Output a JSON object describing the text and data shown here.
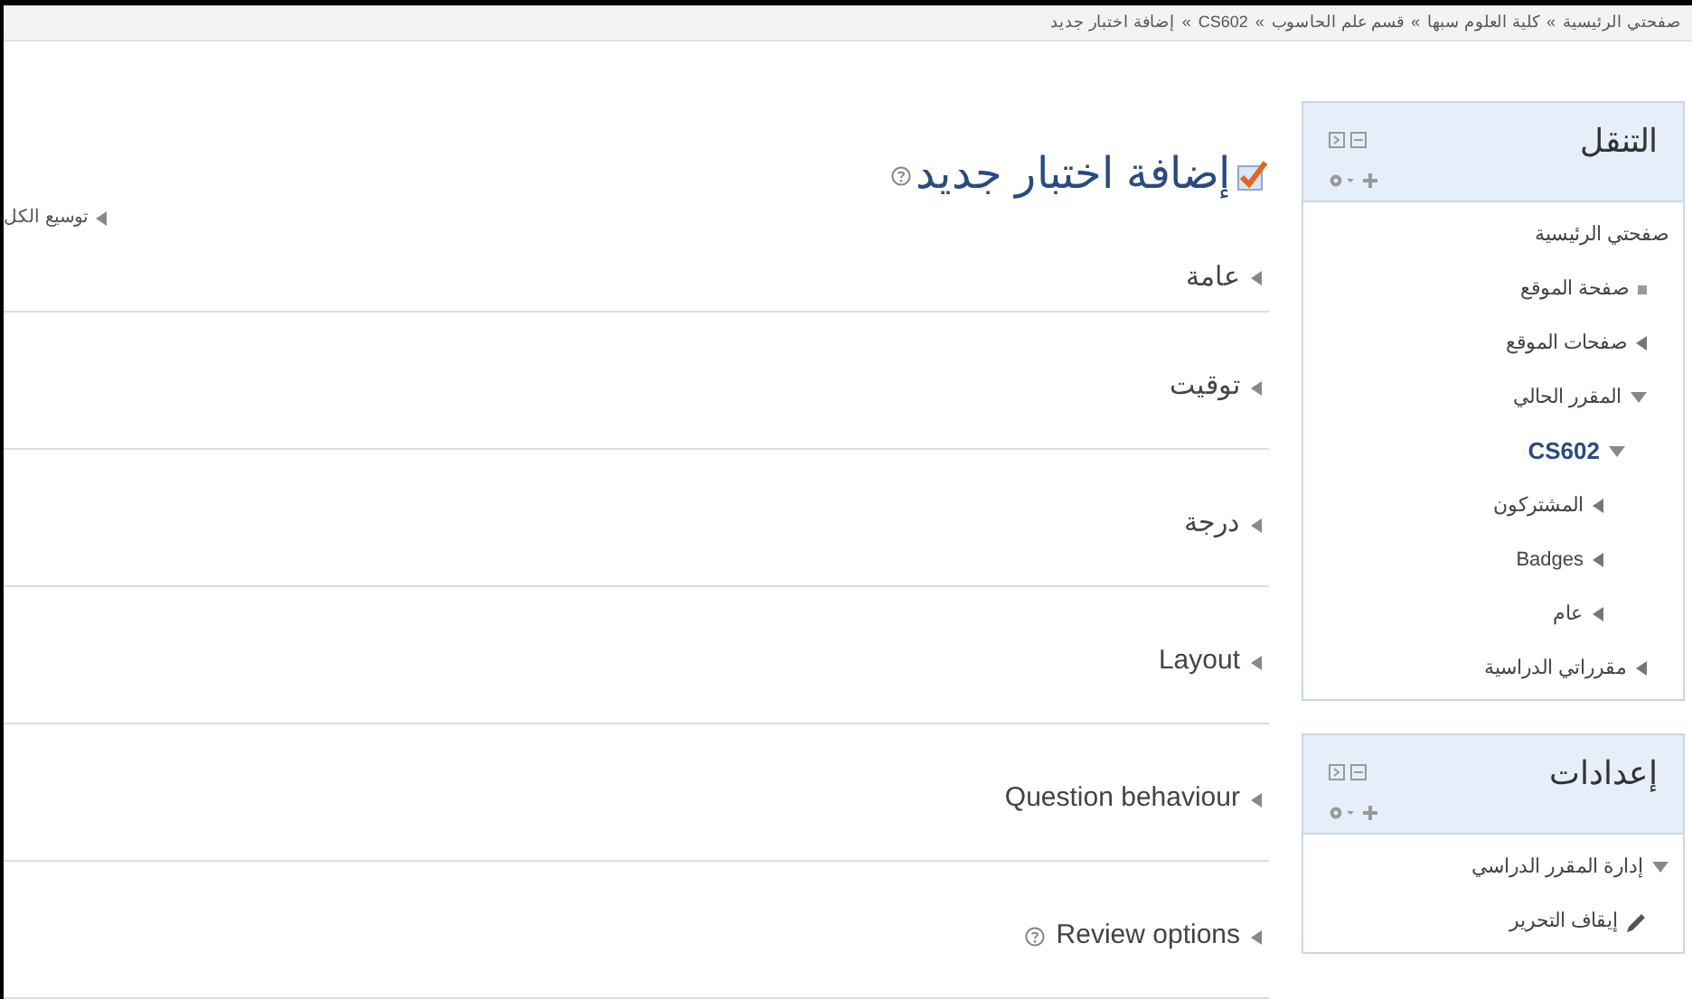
{
  "breadcrumb": {
    "separator": "»",
    "items": [
      "صفحتي الرئيسية",
      "كلية العلوم سبها",
      "قسم علم الحاسوب",
      "CS602",
      "إضافة اختبار جديد"
    ]
  },
  "navigation": {
    "title": "التنقل",
    "items": [
      {
        "label": "صفحتي الرئيسية",
        "children": [
          {
            "label": "صفحة الموقع",
            "kind": "leaf"
          },
          {
            "label": "صفحات الموقع",
            "kind": "collapsed"
          },
          {
            "label": "المقرر الحالي",
            "kind": "expanded",
            "children": [
              {
                "label": "CS602",
                "kind": "expanded",
                "current": true,
                "children": [
                  {
                    "label": "المشتركون",
                    "kind": "collapsed"
                  },
                  {
                    "label": "Badges",
                    "kind": "collapsed"
                  },
                  {
                    "label": "عام",
                    "kind": "collapsed"
                  }
                ]
              }
            ]
          },
          {
            "label": "مقرراتي الدراسية",
            "kind": "collapsed"
          }
        ]
      }
    ]
  },
  "settings": {
    "title": "إعدادات",
    "items": [
      {
        "label": "إدارة المقرر الدراسي",
        "kind": "expanded",
        "children": [
          {
            "label": "إيقاف التحرير",
            "kind": "edit"
          }
        ]
      }
    ]
  },
  "page_title": "إضافة اختبار جديد",
  "expand_all": "توسيع الكل",
  "sections": [
    {
      "label": "عامة",
      "help": false
    },
    {
      "label": "توقيت",
      "help": false
    },
    {
      "label": "درجة",
      "help": false
    },
    {
      "label": "Layout",
      "help": false
    },
    {
      "label": "Question behaviour",
      "help": false
    },
    {
      "label": "Review options",
      "help": true
    }
  ]
}
